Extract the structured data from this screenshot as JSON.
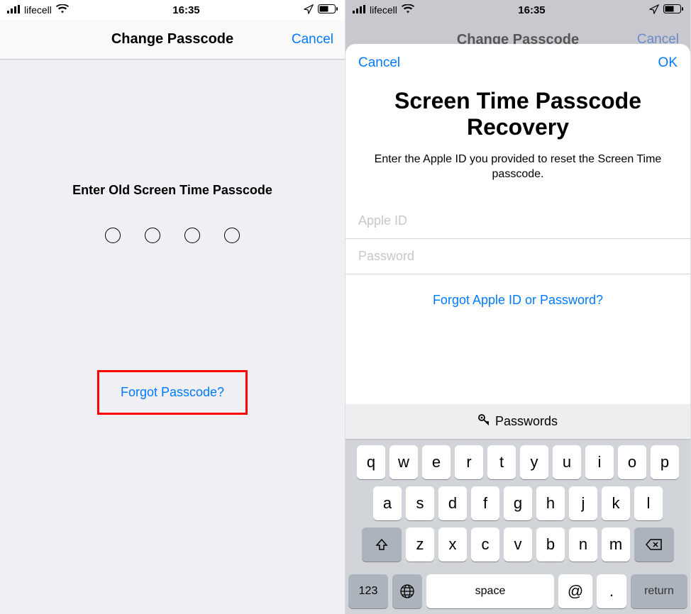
{
  "status": {
    "carrier": "lifecell",
    "time": "16:35"
  },
  "left": {
    "nav_title": "Change Passcode",
    "nav_cancel": "Cancel",
    "prompt": "Enter Old Screen Time Passcode",
    "forgot": "Forgot Passcode?"
  },
  "right": {
    "nav_title_bg": "Change Passcode",
    "nav_cancel_bg": "Cancel",
    "sheet_cancel": "Cancel",
    "sheet_ok": "OK",
    "sheet_title": "Screen Time Passcode Recovery",
    "sheet_sub": "Enter the Apple ID you provided to reset the Screen Time passcode.",
    "apple_id_placeholder": "Apple ID",
    "password_placeholder": "Password",
    "forgot_apple": "Forgot Apple ID or Password?"
  },
  "keyboard": {
    "suggestion": "Passwords",
    "row1": [
      "q",
      "w",
      "e",
      "r",
      "t",
      "y",
      "u",
      "i",
      "o",
      "p"
    ],
    "row2": [
      "a",
      "s",
      "d",
      "f",
      "g",
      "h",
      "j",
      "k",
      "l"
    ],
    "row3": [
      "z",
      "x",
      "c",
      "v",
      "b",
      "n",
      "m"
    ],
    "key_123": "123",
    "key_space": "space",
    "key_at": "@",
    "key_dot": ".",
    "key_return": "return"
  }
}
